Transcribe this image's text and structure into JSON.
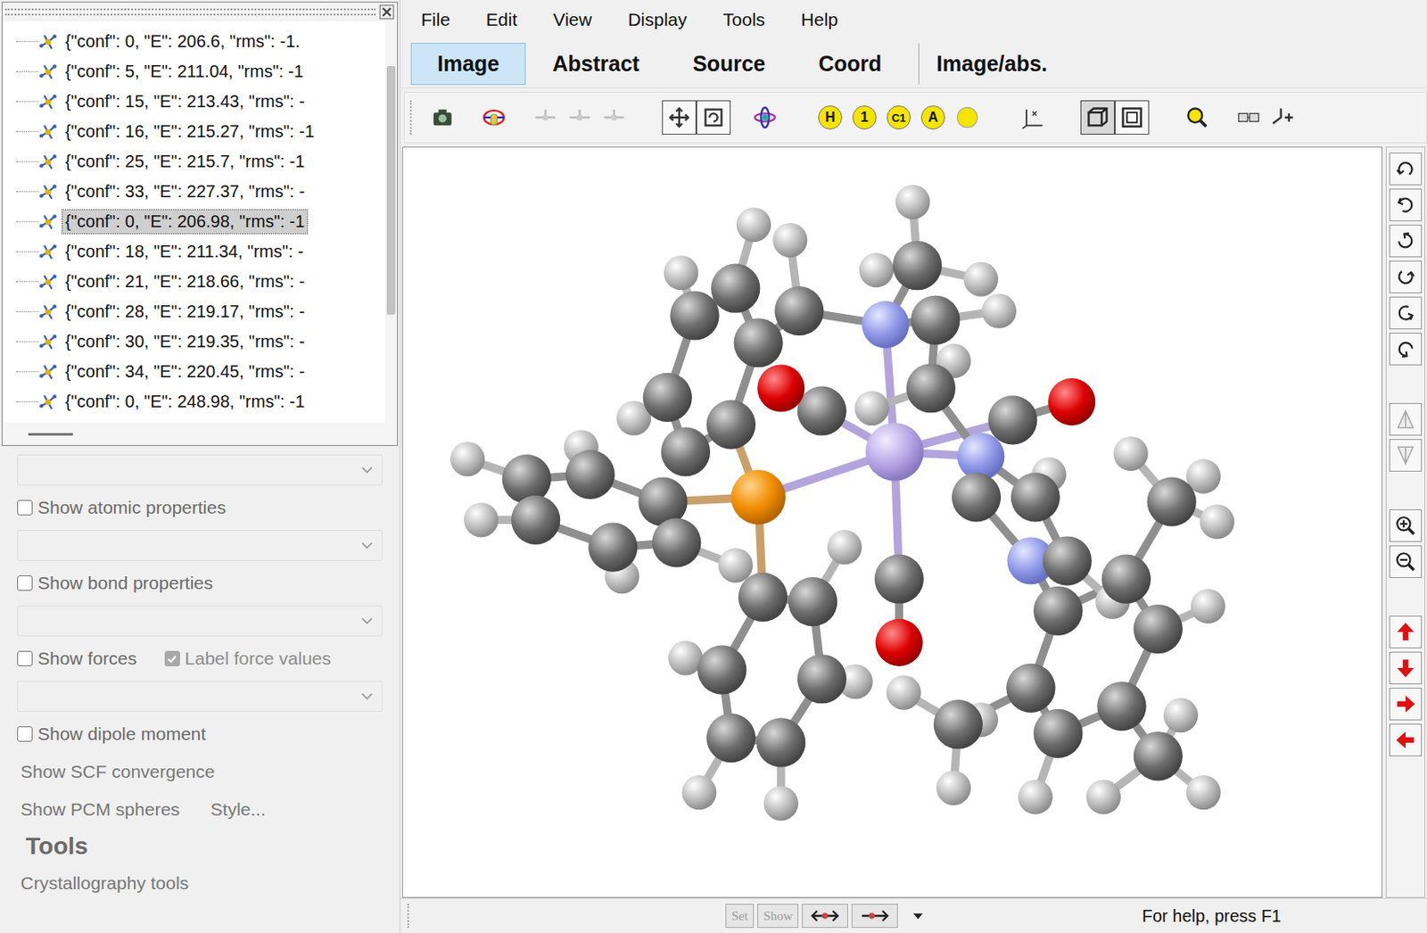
{
  "menu": [
    "File",
    "Edit",
    "View",
    "Display",
    "Tools",
    "Help"
  ],
  "tabs": [
    {
      "label": "Image",
      "selected": true
    },
    {
      "label": "Abstract",
      "selected": false
    },
    {
      "label": "Source",
      "selected": false
    },
    {
      "label": "Coord",
      "selected": false
    },
    {
      "label": "Image/abs.",
      "selected": false
    }
  ],
  "toolbar": {
    "label_buttons": [
      "H",
      "1",
      "C1",
      "A"
    ]
  },
  "tree": {
    "items": [
      {
        "text": "{\"conf\": 0, \"E\": 206.6, \"rms\": -1.",
        "selected": false
      },
      {
        "text": "{\"conf\": 5, \"E\": 211.04, \"rms\": -1",
        "selected": false
      },
      {
        "text": "{\"conf\": 15, \"E\": 213.43, \"rms\": -",
        "selected": false
      },
      {
        "text": "{\"conf\": 16, \"E\": 215.27, \"rms\": -1",
        "selected": false
      },
      {
        "text": "{\"conf\": 25, \"E\": 215.7, \"rms\": -1",
        "selected": false
      },
      {
        "text": "{\"conf\": 33, \"E\": 227.37, \"rms\": -",
        "selected": false
      },
      {
        "text": "{\"conf\": 0, \"E\": 206.98, \"rms\": -1",
        "selected": true
      },
      {
        "text": "{\"conf\": 18, \"E\": 211.34, \"rms\": -",
        "selected": false
      },
      {
        "text": "{\"conf\": 21, \"E\": 218.66, \"rms\": -",
        "selected": false
      },
      {
        "text": "{\"conf\": 28, \"E\": 219.17, \"rms\": -",
        "selected": false
      },
      {
        "text": "{\"conf\": 30, \"E\": 219.35, \"rms\": -",
        "selected": false
      },
      {
        "text": "{\"conf\": 34, \"E\": 220.45, \"rms\": -",
        "selected": false
      },
      {
        "text": "{\"conf\": 0, \"E\": 248.98, \"rms\": -1",
        "selected": false
      }
    ]
  },
  "panel": [
    {
      "kind": "dropdown",
      "disabled": true
    },
    {
      "kind": "checkbox",
      "items": [
        {
          "label": "Show atomic properties",
          "checked": false,
          "disabled": false
        }
      ]
    },
    {
      "kind": "dropdown",
      "disabled": true
    },
    {
      "kind": "checkbox",
      "items": [
        {
          "label": "Show bond properties",
          "checked": false,
          "disabled": false
        }
      ]
    },
    {
      "kind": "dropdown",
      "disabled": true
    },
    {
      "kind": "checkbox",
      "items": [
        {
          "label": "Show forces",
          "checked": false,
          "disabled": false
        },
        {
          "label": "Label force values",
          "checked": true,
          "disabled": true
        }
      ]
    },
    {
      "kind": "dropdown",
      "disabled": true
    },
    {
      "kind": "checkbox",
      "items": [
        {
          "label": "Show dipole moment",
          "checked": false,
          "disabled": false
        }
      ]
    },
    {
      "kind": "links",
      "items": [
        "Show SCF convergence"
      ]
    },
    {
      "kind": "links",
      "items": [
        "Show PCM spheres",
        "Style..."
      ]
    },
    {
      "kind": "heading",
      "text": "Tools"
    },
    {
      "kind": "links",
      "items": [
        "Crystallography tools"
      ]
    }
  ],
  "status_bar": {
    "buttons": [
      {
        "label": "Set",
        "disabled": true
      },
      {
        "label": "Show",
        "disabled": true
      }
    ],
    "message": "For help, press F1"
  }
}
